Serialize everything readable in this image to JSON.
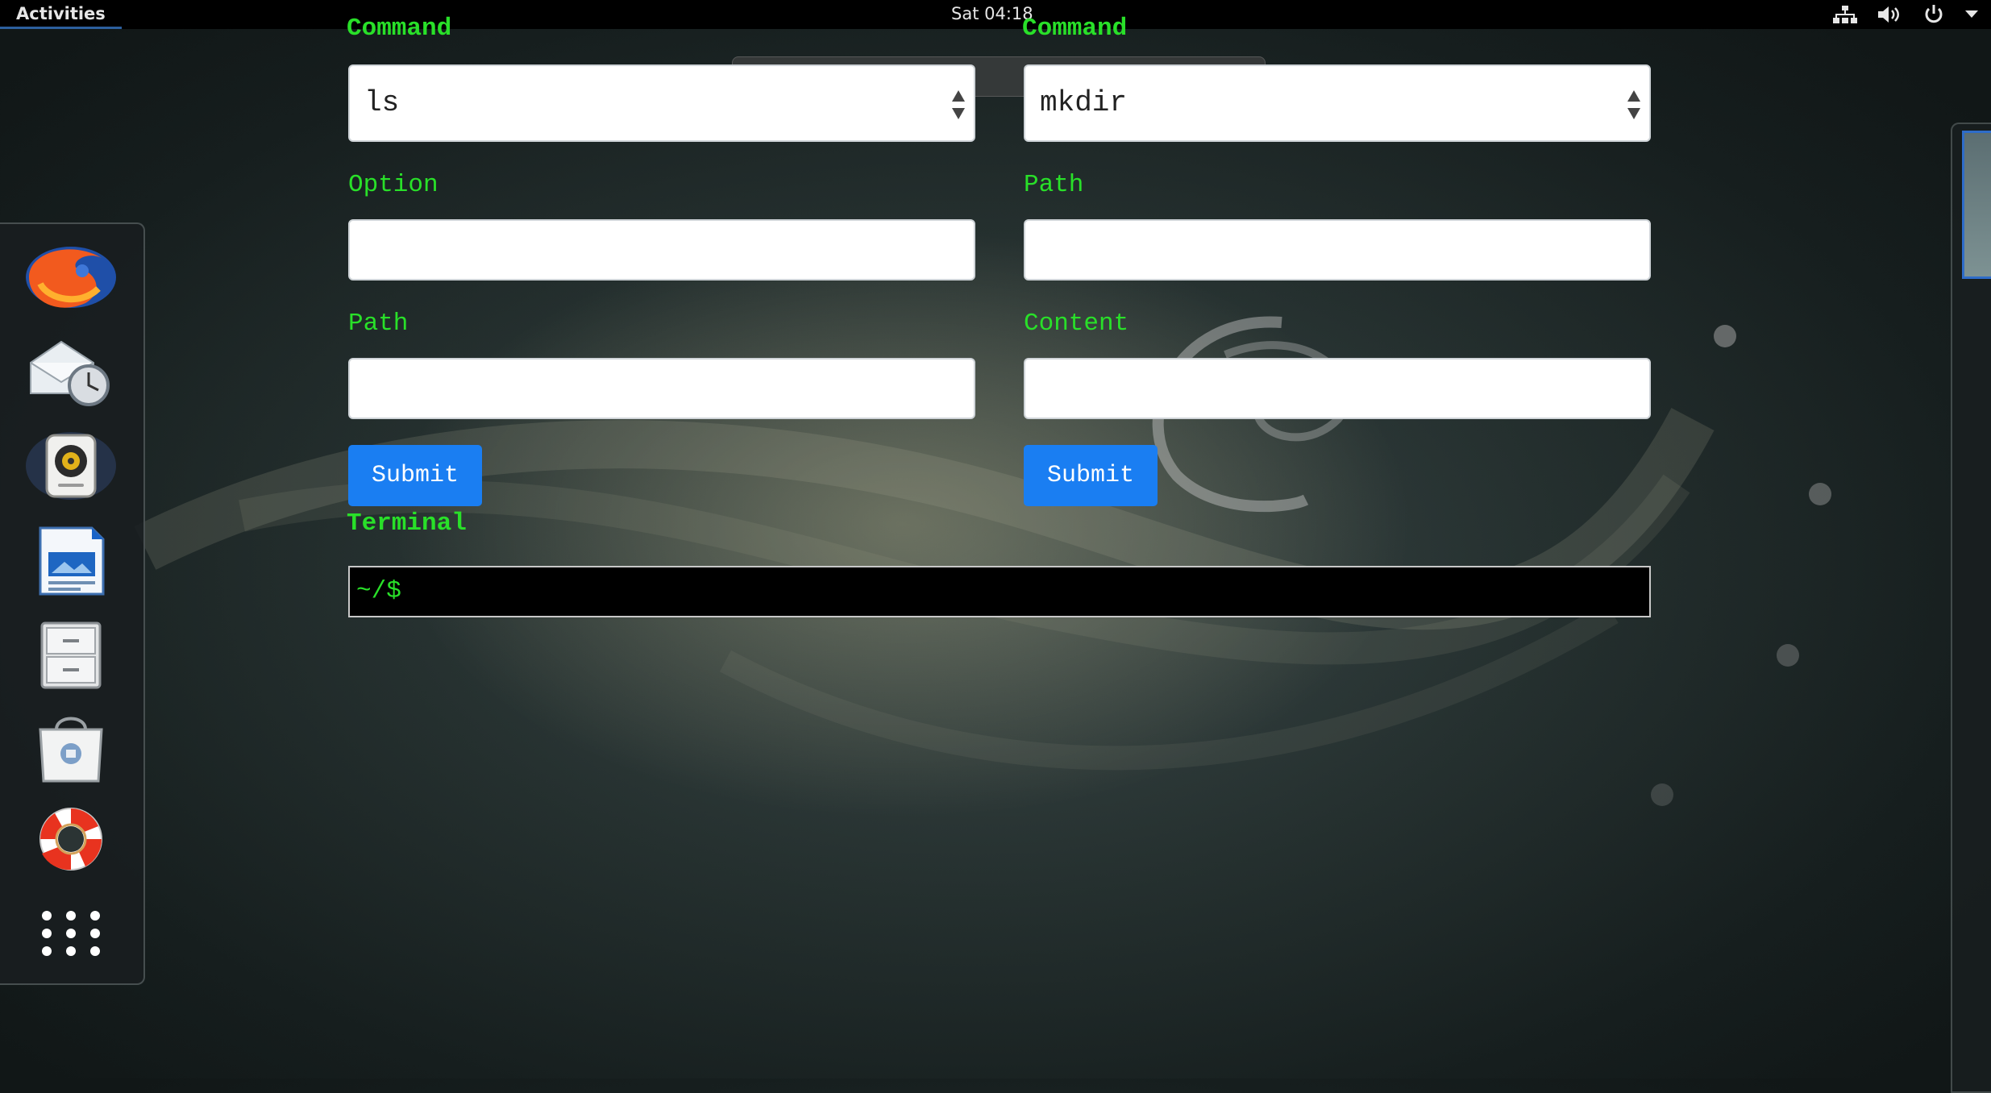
{
  "topbar": {
    "activities": "Activities",
    "clock": "Sat 04:18",
    "tray_icons": [
      "network-icon",
      "volume-icon",
      "power-icon",
      "menu-arrow-icon"
    ]
  },
  "dash": {
    "apps": [
      {
        "name": "Firefox",
        "icon": "firefox-icon"
      },
      {
        "name": "Evolution",
        "icon": "mail-clock-icon"
      },
      {
        "name": "Rhythmbox",
        "icon": "speaker-icon"
      },
      {
        "name": "LibreOffice Impress",
        "icon": "presentation-icon"
      },
      {
        "name": "Files",
        "icon": "file-cabinet-icon"
      },
      {
        "name": "Software",
        "icon": "shopping-bag-icon"
      },
      {
        "name": "Help",
        "icon": "lifebuoy-icon"
      },
      {
        "name": "Show Applications",
        "icon": "app-grid-icon"
      }
    ]
  },
  "form_left": {
    "command_label": "Command",
    "command_value": "ls",
    "option_label": "Option",
    "option_value": "",
    "path_label": "Path",
    "path_value": "",
    "submit_label": "Submit"
  },
  "form_right": {
    "command_label": "Command",
    "command_value": "mkdir",
    "path_label": "Path",
    "path_value": "",
    "content_label": "Content",
    "content_value": "",
    "submit_label": "Submit"
  },
  "terminal": {
    "label": "Terminal",
    "prompt": "~/$"
  },
  "colors": {
    "label_green": "#29e029",
    "button_blue": "#1a7ef2",
    "topbar": "#000000"
  }
}
